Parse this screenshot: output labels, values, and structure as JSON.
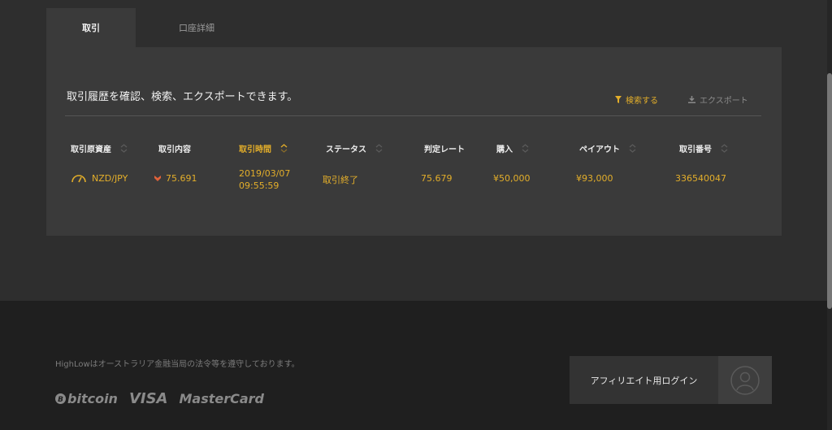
{
  "tabs": [
    {
      "label": "取引"
    },
    {
      "label": "口座詳細"
    }
  ],
  "panel": {
    "intro_text": "取引履歴を確認、検索、エクスポートできます。",
    "search_label": "検索する",
    "export_label": "エクスポート"
  },
  "table": {
    "columns": [
      "取引原資産",
      "取引内容",
      "取引時間",
      "ステータス",
      "判定レート",
      "購入",
      "ペイアウト",
      "取引番号"
    ],
    "active_sort_column": "取引時間",
    "rows": [
      {
        "asset": "NZD/JPY",
        "direction": "down",
        "entry_rate": "75.691",
        "date": "2019/03/07",
        "time": "09:55:59",
        "status": "取引終了",
        "closing_rate": "75.679",
        "purchase": "¥50,000",
        "payout": "¥93,000",
        "trade_id": "336540047"
      }
    ]
  },
  "footer": {
    "legal_text": "HighLowはオーストラリア金融当局の法令等を遵守しております。",
    "logos": [
      "bitcoin",
      "VISA",
      "MasterCard"
    ],
    "affiliate_login_label": "アフィリエイト用ログイン"
  },
  "colors": {
    "accent": "#e3ae2a",
    "down_arrow": "#e0623a",
    "panel_bg": "#3a3a3a",
    "page_bg": "#2e2e2e",
    "footer_bg": "#1f1f1f"
  },
  "icons": [
    "filter-icon",
    "download-icon",
    "sort-icon",
    "gauge-icon",
    "down-arrow-icon",
    "user-icon"
  ]
}
